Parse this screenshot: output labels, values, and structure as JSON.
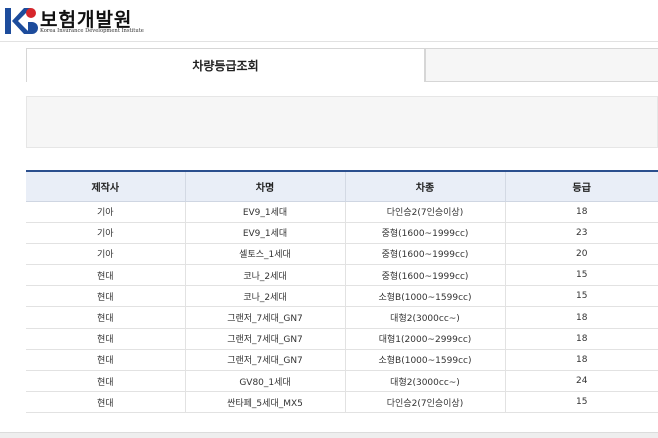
{
  "header": {
    "org_name": "보험개발원",
    "org_subtitle": "Korea Insurance Development Institute",
    "colors": {
      "logo_red": "#d6262b",
      "logo_blue": "#1d4c9c"
    }
  },
  "tabs": [
    {
      "label": "차량등급조회",
      "active": true
    },
    {
      "label": "",
      "active": false
    }
  ],
  "table": {
    "headers": [
      "제작사",
      "차명",
      "차종",
      "등급"
    ],
    "rows": [
      [
        "기아",
        "EV9_1세대",
        "다인승2(7인승이상)",
        "18"
      ],
      [
        "기아",
        "EV9_1세대",
        "중형(1600~1999cc)",
        "23"
      ],
      [
        "기아",
        "셀토스_1세대",
        "중형(1600~1999cc)",
        "20"
      ],
      [
        "현대",
        "코나_2세대",
        "중형(1600~1999cc)",
        "15"
      ],
      [
        "현대",
        "코나_2세대",
        "소형B(1000~1599cc)",
        "15"
      ],
      [
        "현대",
        "그랜저_7세대_GN7",
        "대형2(3000cc~)",
        "18"
      ],
      [
        "현대",
        "그랜저_7세대_GN7",
        "대형1(2000~2999cc)",
        "18"
      ],
      [
        "현대",
        "그랜저_7세대_GN7",
        "소형B(1000~1599cc)",
        "18"
      ],
      [
        "현대",
        "GV80_1세대",
        "대형2(3000cc~)",
        "24"
      ],
      [
        "현대",
        "싼타페_5세대_MX5",
        "다인승2(7인승이상)",
        "15"
      ]
    ],
    "colors": {
      "header_bg": "#e9eef7",
      "top_border": "#2b4f8e"
    }
  }
}
